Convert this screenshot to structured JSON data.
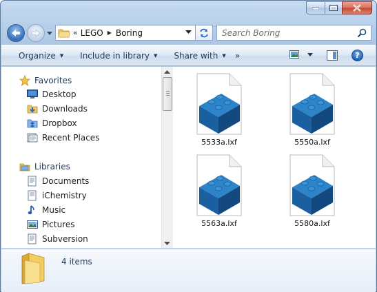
{
  "window": {
    "accent": "#1f5fb4"
  },
  "address": {
    "overflow_marker": "«",
    "crumbs": [
      "LEGO",
      "Boring"
    ]
  },
  "search": {
    "placeholder": "Search Boring"
  },
  "toolbar": {
    "organize": "Organize",
    "include_in_library": "Include in library",
    "share_with": "Share with",
    "more": "»",
    "help": "?"
  },
  "sidebar": {
    "favorites": {
      "label": "Favorites",
      "items": [
        "Desktop",
        "Downloads",
        "Dropbox",
        "Recent Places"
      ]
    },
    "libraries": {
      "label": "Libraries",
      "items": [
        "Documents",
        "iChemistry",
        "Music",
        "Pictures",
        "Subversion"
      ]
    }
  },
  "files": [
    {
      "name": "5533a.lxf",
      "icon": "lego-brick-file-icon"
    },
    {
      "name": "5550a.lxf",
      "icon": "lego-brick-file-icon"
    },
    {
      "name": "5563a.lxf",
      "icon": "lego-brick-file-icon"
    },
    {
      "name": "5580a.lxf",
      "icon": "lego-brick-file-icon"
    }
  ],
  "details": {
    "item_count": "4 items"
  }
}
